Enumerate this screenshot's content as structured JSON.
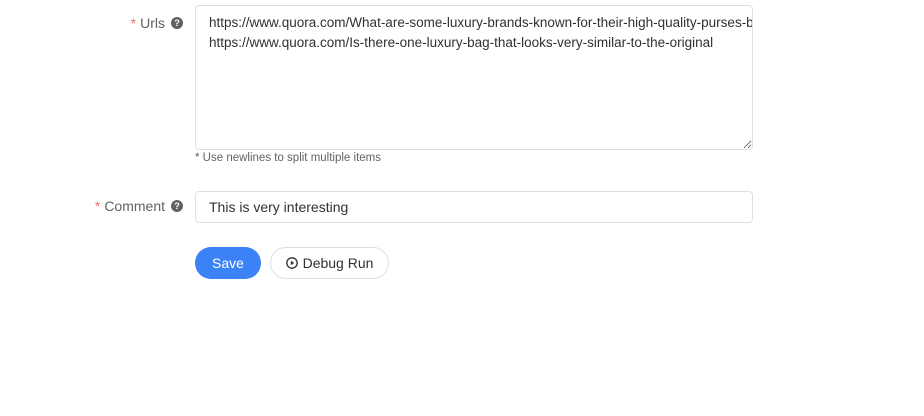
{
  "form": {
    "required_mark": "*",
    "urls": {
      "label": "Urls",
      "value": "https://www.quora.com/What-are-some-luxury-brands-known-for-their-high-quality-purses-bags\nhttps://www.quora.com/Is-there-one-luxury-bag-that-looks-very-similar-to-the-original",
      "hint": "* Use newlines to split multiple items",
      "help_icon": "question-circle-icon"
    },
    "comment": {
      "label": "Comment",
      "value": "This is very interesting",
      "help_icon": "question-circle-icon"
    },
    "buttons": {
      "save_label": "Save",
      "debug_label": "Debug Run",
      "debug_icon": "play-circle-icon"
    }
  },
  "colors": {
    "primary": "#3b82f6",
    "required": "#f56c6c",
    "border": "#dcdfe6"
  }
}
